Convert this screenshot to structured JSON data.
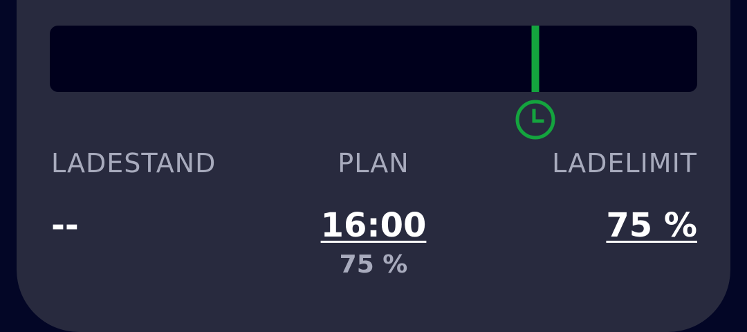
{
  "colors": {
    "page_background": "#030626",
    "card_background": "#282a3e",
    "bar_background": "#00001c",
    "plan_marker": "#14a43e",
    "label_text": "#a8abbd",
    "value_text": "#ffffff"
  },
  "plan_bar": {
    "marker_percent": 75,
    "marker_icon": "clock-icon"
  },
  "ladestand": {
    "label": "LADESTAND",
    "value": "--"
  },
  "plan": {
    "label": "PLAN",
    "time": "16:00",
    "soc": "75 %"
  },
  "ladelimit": {
    "label": "LADELIMIT",
    "value": "75 %"
  }
}
